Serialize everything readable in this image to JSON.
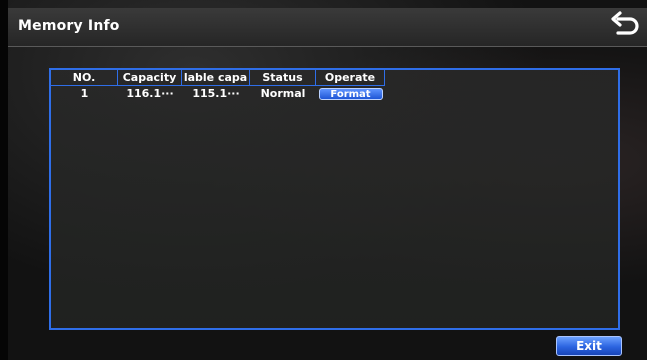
{
  "header": {
    "title": "Memory Info",
    "back_icon": "back-arrow-icon"
  },
  "table": {
    "columns": [
      "NO.",
      "Capacity",
      "lable capa",
      "Status",
      "Operate"
    ],
    "rows": [
      {
        "no": "1",
        "capacity": "116.1···",
        "available": "115.1···",
        "status": "Normal",
        "operate": "Format"
      }
    ]
  },
  "footer": {
    "exit_label": "Exit"
  },
  "colors": {
    "accent": "#2f6ee8",
    "button": "#2b63e0",
    "text": "#ffffff"
  }
}
